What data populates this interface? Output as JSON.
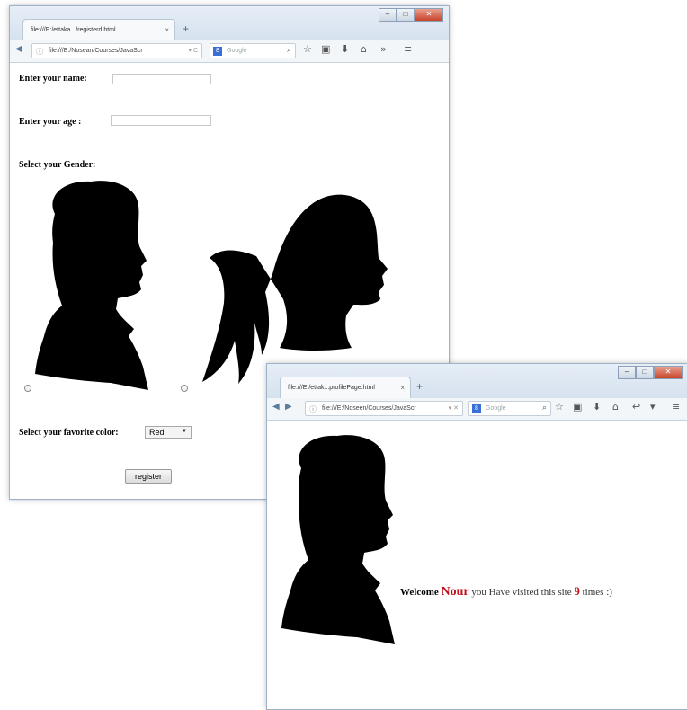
{
  "window1": {
    "tab_title": "file:///E:/ettaka.../registerd.html",
    "tab_close": "×",
    "new_tab": "+",
    "url": "file:///E:/Nosean/Courses/JavaScr",
    "search_placeholder": "Google",
    "form": {
      "name_label": "Enter your name:",
      "name_value": "",
      "age_label": "Enter your age :",
      "age_value": "",
      "gender_label": "Select your Gender:",
      "color_label": "Select your favorite color:",
      "color_selected": "Red",
      "register_button": "register"
    }
  },
  "window2": {
    "tab_title": "file:///E:/ettak...profilePage.html",
    "tab_close": "×",
    "new_tab": "+",
    "url": "file:///E:/Noseen/Courses/JavaScr",
    "search_placeholder": "Google",
    "welcome": {
      "prefix": "Welcome",
      "name": "Nour",
      "middle": "you Have visited this site",
      "count": "9",
      "suffix": "times :)"
    }
  },
  "icons": [
    "back-icon",
    "forward-icon",
    "search-icon",
    "star-icon",
    "clipboard-icon",
    "download-icon",
    "home-icon",
    "overflow-icon",
    "menu-icon",
    "male-silhouette-icon",
    "female-silhouette-icon"
  ],
  "colors": {
    "accent_red": "#c0101a",
    "chrome": "#dfe8f2"
  }
}
